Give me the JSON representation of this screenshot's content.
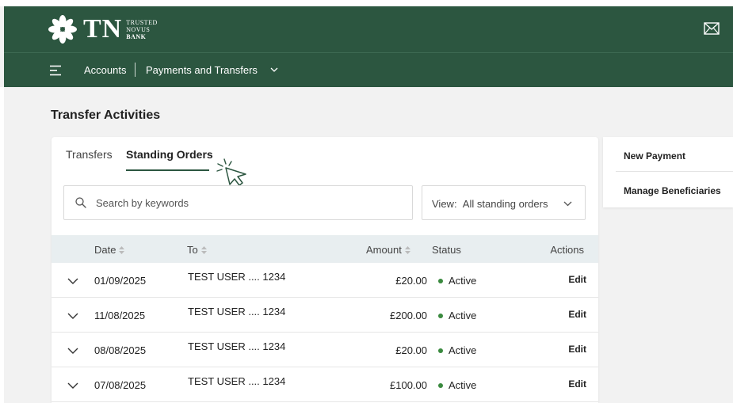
{
  "brand": {
    "logo_text": "TN",
    "tagline": [
      "TRUSTED",
      "NOVUS",
      "BANK"
    ]
  },
  "nav": {
    "accounts": "Accounts",
    "payments": "Payments and Transfers"
  },
  "page": {
    "title": "Transfer Activities"
  },
  "tabs": [
    {
      "label": "Transfers",
      "active": false
    },
    {
      "label": "Standing Orders",
      "active": true
    }
  ],
  "search": {
    "placeholder": "Search by keywords",
    "value": ""
  },
  "view_filter": {
    "label": "View:",
    "selected": "All standing orders"
  },
  "table": {
    "headers": {
      "date": "Date",
      "to": "To",
      "amount": "Amount",
      "status": "Status",
      "actions": "Actions"
    },
    "rows": [
      {
        "date": "01/09/2025",
        "to": "TEST USER .... 1234",
        "amount": "£20.00",
        "status": "Active",
        "action": "Edit"
      },
      {
        "date": "11/08/2025",
        "to": "TEST USER .... 1234",
        "amount": "£200.00",
        "status": "Active",
        "action": "Edit"
      },
      {
        "date": "08/08/2025",
        "to": "TEST USER .... 1234",
        "amount": "£20.00",
        "status": "Active",
        "action": "Edit"
      },
      {
        "date": "07/08/2025",
        "to": "TEST USER .... 1234",
        "amount": "£100.00",
        "status": "Active",
        "action": "Edit"
      }
    ]
  },
  "side_menu": {
    "new_payment": "New Payment",
    "manage_beneficiaries": "Manage Beneficiaries"
  },
  "icons": {
    "logo": "star-flower-logo-icon",
    "mail": "mail-icon",
    "menu": "hamburger-menu-icon",
    "search": "search-icon",
    "chevron": "chevron-down-icon",
    "sort": "sort-icon",
    "cursor": "pointer-cursor-icon"
  },
  "colors": {
    "header_green": "#2c5640",
    "status_active": "#3a8a3f",
    "table_header_bg": "#e8eef0",
    "page_bg": "#f2f2f2"
  }
}
